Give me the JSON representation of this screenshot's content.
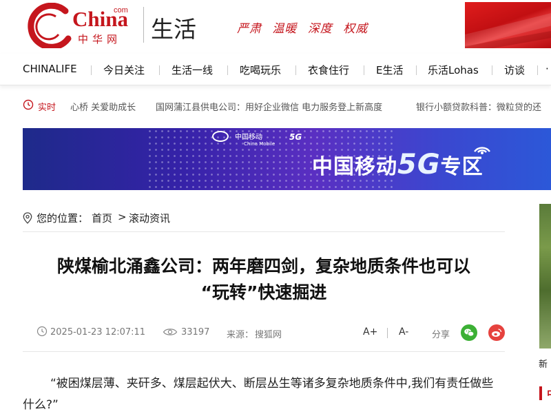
{
  "header": {
    "logo_com": "com",
    "logo_word": "China",
    "logo_cn": "中华网",
    "channel": "生活",
    "slogan": [
      "严肃",
      "温暖",
      "深度",
      "权威"
    ]
  },
  "nav": {
    "items": [
      "CHINALIFE",
      "今日关注",
      "生活一线",
      "吃喝玩乐",
      "衣食住行",
      "E生活",
      "乐活Lohas",
      "访谈",
      "·"
    ]
  },
  "ticker": {
    "label": "实时",
    "items": [
      "心桥 关爱助成长",
      "国网蒲江县供电公司：用好企业微信 电力服务登上新高度",
      "银行小额贷款科普：微粒贷的还"
    ]
  },
  "ad": {
    "brand": "中国移动",
    "brand_en": "China Mobile",
    "brand_5g": "5G",
    "text_pre": "中国移动",
    "text_5g": "5G",
    "text_post": "专区"
  },
  "breadcrumb": {
    "label": "您的位置：",
    "home": "首页",
    "separator": ">",
    "current": "滚动资讯"
  },
  "article": {
    "title_line1": "陕煤榆北涌鑫公司：两年磨四剑，复杂地质条件也可以",
    "title_line2": "“玩转”快速掘进",
    "date": "2025-01-23 12:07:11",
    "views": "33197",
    "source_label": "来源：",
    "source": "搜狐网",
    "font_up": "A+",
    "font_down": "A-",
    "share_label": "分享",
    "body": "“被困煤层薄、夹矸多、煤层起伏大、断层丛生等诸多复杂地质条件中,我们有责任做些什么?”"
  },
  "side": {
    "caption": "新",
    "heading": "中"
  },
  "colors": {
    "brand_red": "#c5161d",
    "wechat_green": "#3cb035",
    "weibo_red": "#e6423e"
  }
}
